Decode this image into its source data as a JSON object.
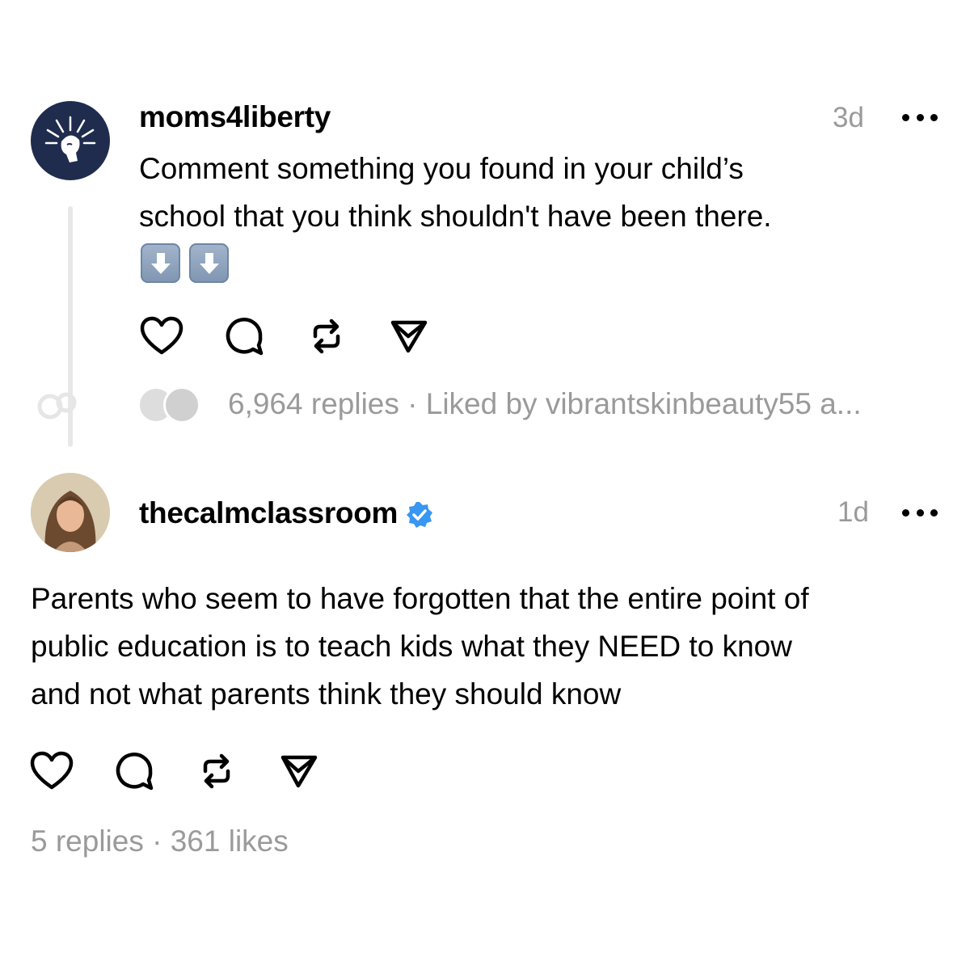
{
  "post1": {
    "username": "moms4liberty",
    "time": "3d",
    "text_line1": "Comment something you found in your child’s",
    "text_line2": "school that you think shouldn't have been there.",
    "emojis": [
      "down-arrow-emoji",
      "down-arrow-emoji"
    ],
    "meta": "6,964 replies · Liked by vibrantskinbeauty55 a..."
  },
  "post2": {
    "username": "thecalmclassroom",
    "verified": true,
    "time": "1d",
    "text_line1": "Parents who seem to have forgotten that the entire point of",
    "text_line2": "public education is to teach kids what they NEED to know",
    "text_line3": "and not what parents think they should know",
    "meta": "5 replies · 361 likes"
  },
  "icons": [
    "heart-icon",
    "comment-icon",
    "repost-icon",
    "share-icon",
    "more-icon",
    "verified-icon"
  ],
  "colors": {
    "verified": "#3897f0",
    "muted": "#9a9a9a",
    "avatar_bg": "#1f2c4e"
  }
}
